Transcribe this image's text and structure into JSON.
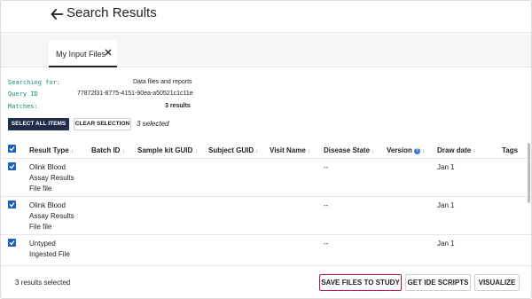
{
  "header": {
    "title": "Search Results",
    "back_icon": "arrow-left-icon"
  },
  "tabs": [
    {
      "label": "My Input Files",
      "close_icon": "close-icon"
    }
  ],
  "meta": {
    "searching_for_label": "Searching for:",
    "searching_for_value": "Data files and reports",
    "query_id_label": "Query ID",
    "query_id_value": "77872f31-8775-4151-90ea-a50521c1c11e",
    "matches_label": "Matches:",
    "matches_value": "3 results"
  },
  "toolbar": {
    "select_all_label": "SELECT ALL ITEMS",
    "clear_selection_label": "CLEAR SELECTION",
    "selected_count": "3 selected"
  },
  "table": {
    "columns": [
      "Result Type",
      "Batch ID",
      "Sample kit GUID",
      "Subject GUID",
      "Visit Name",
      "Disease State",
      "Version",
      "Draw date",
      "Tags"
    ],
    "sort_icon": "↓",
    "info_icon": "info-icon",
    "rows": [
      {
        "result_type": [
          "Olink Blood",
          "Assay Results",
          "File file"
        ],
        "disease_state": "--",
        "draw_date": "Jan 1",
        "checked": true
      },
      {
        "result_type": [
          "Olink Blood",
          "Assay Results",
          "File file"
        ],
        "disease_state": "--",
        "draw_date": "Jan 1",
        "checked": true
      },
      {
        "result_type": [
          "Untyped",
          "Ingested File"
        ],
        "disease_state": "--",
        "draw_date": "Jan 1",
        "checked": true
      }
    ]
  },
  "footer": {
    "status": "3 results selected",
    "save_label": "SAVE FILES TO STUDY",
    "ide_label": "GET IDE SCRIPTS",
    "visualize_label": "VISUALIZE"
  },
  "colors": {
    "accent_dark": "#1f2d4b",
    "checkbox": "#1d5fbf",
    "primary_border": "#b0124a",
    "mono_label": "#1a8a7a"
  }
}
